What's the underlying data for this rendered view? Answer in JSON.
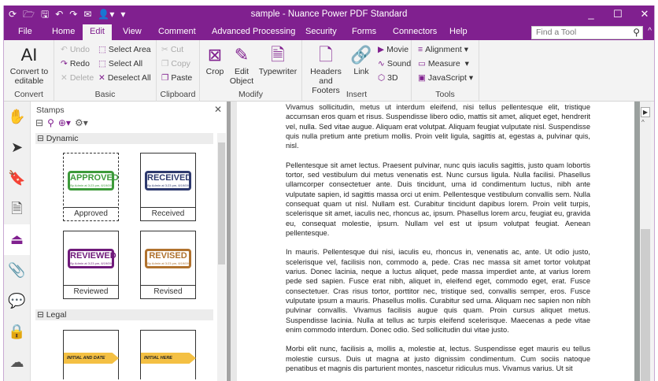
{
  "window": {
    "title": "sample - Nuance Power PDF Standard",
    "minimize": "_",
    "maximize": "☐",
    "close": "✕"
  },
  "quick_access": [
    "⟳",
    "🗁",
    "🖫",
    "↶",
    "↷",
    "✉",
    "👤▾",
    "▾"
  ],
  "tabs": [
    {
      "label": "File"
    },
    {
      "label": "Home"
    },
    {
      "label": "Edit",
      "active": true
    },
    {
      "label": "View"
    },
    {
      "label": "Comment"
    },
    {
      "label": "Advanced Processing"
    },
    {
      "label": "Security"
    },
    {
      "label": "Forms"
    },
    {
      "label": "Connectors"
    },
    {
      "label": "Help"
    }
  ],
  "search": {
    "placeholder": "Find a Tool",
    "collapse": "^"
  },
  "ribbon": {
    "convert": {
      "label": "Convert to editable",
      "group": "Convert"
    },
    "basic": {
      "group": "Basic",
      "undo": "Undo",
      "redo": "Redo",
      "delete": "Delete",
      "select_area": "Select Area",
      "select_all": "Select All",
      "deselect_all": "Deselect All"
    },
    "clipboard": {
      "group": "Clipboard",
      "cut": "Cut",
      "copy": "Copy",
      "paste": "Paste"
    },
    "modify": {
      "group": "Modify",
      "crop": "Crop",
      "edit_object": "Edit Object",
      "typewriter": "Typewriter"
    },
    "insert": {
      "group": "Insert",
      "headers_footers": "Headers and Footers",
      "link": "Link",
      "movie": "Movie",
      "sound": "Sound",
      "three_d": "3D"
    },
    "tools": {
      "group": "Tools",
      "alignment": "Alignment",
      "measure": "Measure",
      "javascript": "JavaScript"
    }
  },
  "stamps_panel": {
    "title": "Stamps",
    "close": "✕",
    "sections": [
      {
        "name": "Dynamic",
        "stamps": [
          {
            "caption": "Approved",
            "text": "APPROVED",
            "sub": "By Admin at 3:23 pm, 8/19/09",
            "color": "#3d9a3a"
          },
          {
            "caption": "Received",
            "text": "RECEIVED",
            "sub": "By Admin at 3:23 pm, 8/19/09",
            "color": "#2e3a6e"
          },
          {
            "caption": "Reviewed",
            "text": "REVIEWED",
            "sub": "By Admin at 3:23 pm, 8/19/09",
            "color": "#6f1a7a"
          },
          {
            "caption": "Revised",
            "text": "REVISED",
            "sub": "By Admin at 3:23 pm, 8/19/09",
            "color": "#b0722e"
          }
        ]
      },
      {
        "name": "Legal",
        "stamps": [
          {
            "text": "INITIAL AND DATE"
          },
          {
            "text": "INITIAL HERE"
          }
        ]
      }
    ]
  },
  "document": {
    "paragraphs": [
      "Vivamus sollicitudin, metus ut interdum eleifend, nisi tellus pellentesque elit, tristique accumsan eros quam et risus. Suspendisse libero odio, mattis sit amet, aliquet eget, hendrerit vel, nulla. Sed vitae augue. Aliquam erat volutpat. Aliquam feugiat vulputate nisl. Suspendisse quis nulla pretium ante pretium mollis. Proin velit ligula, sagittis at, egestas a, pulvinar quis, nisl.",
      "Pellentesque sit amet lectus. Praesent pulvinar, nunc quis iaculis sagittis, justo quam lobortis tortor, sed vestibulum dui metus venenatis est. Nunc cursus ligula. Nulla facilisi. Phasellus ullamcorper consectetuer ante. Duis tincidunt, urna id condimentum luctus, nibh ante vulputate sapien, id sagittis massa orci ut enim. Pellentesque vestibulum convallis sem. Nulla consequat quam ut nisl. Nullam est. Curabitur tincidunt dapibus lorem. Proin velit turpis, scelerisque sit amet, iaculis nec, rhoncus ac, ipsum. Phasellus lorem arcu, feugiat eu, gravida eu, consequat molestie, ipsum. Nullam vel est ut ipsum volutpat feugiat. Aenean pellentesque.",
      "In mauris. Pellentesque dui nisi, iaculis eu, rhoncus in, venenatis ac, ante. Ut odio justo, scelerisque vel, facilisis non, commodo a, pede. Cras nec massa sit amet tortor volutpat varius. Donec lacinia, neque a luctus aliquet, pede massa imperdiet ante, at varius lorem pede sed sapien. Fusce erat nibh, aliquet in, eleifend eget, commodo eget, erat. Fusce consectetuer. Cras risus tortor, porttitor nec, tristique sed, convallis semper, eros. Fusce vulputate ipsum a mauris. Phasellus mollis. Curabitur sed urna. Aliquam nec sapien non nibh pulvinar convallis. Vivamus facilisis augue quis quam. Proin cursus aliquet metus. Suspendisse lacinia. Nulla at tellus ac turpis eleifend scelerisque. Maecenas a pede vitae enim commodo interdum. Donec odio. Sed sollicitudin dui vitae justo.",
      "Morbi elit nunc, facilisis a, mollis a, molestie at, lectus. Suspendisse eget mauris eu tellus molestie cursus. Duis ut magna at justo dignissim condimentum. Cum sociis natoque penatibus et magnis dis parturient montes, nascetur ridiculus mus. Vivamus varius. Ut sit"
    ]
  },
  "colors": {
    "accent": "#80208f"
  }
}
